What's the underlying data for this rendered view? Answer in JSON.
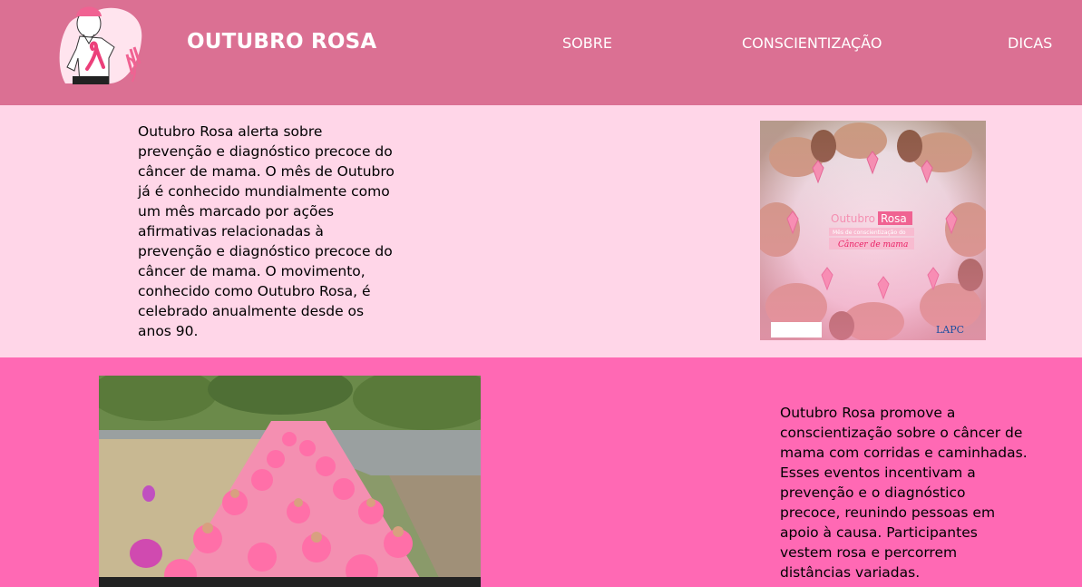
{
  "header": {
    "brand": "OUTUBRO ROSA",
    "nav": [
      {
        "label": "SOBRE"
      },
      {
        "label": "CONSCIENTIZAÇÃO"
      },
      {
        "label": "DICAS"
      }
    ]
  },
  "section1": {
    "text": "Outubro Rosa alerta sobre prevenção e diagnóstico precoce do câncer de mama. O mês de Outubro já é conhecido mundialmente como um mês marcado por ações afirmativas relacionadas à prevenção e diagnóstico precoce do câncer de mama. O movimento, conhecido como Outubro Rosa, é celebrado anualmente desde os anos 90.",
    "image": {
      "title_a": "Outubro",
      "title_b": "Rosa",
      "subtitle": "Mês de conscientização do",
      "script": "Câncer de mama",
      "logo": "LAPC"
    }
  },
  "section2": {
    "text": "Outubro Rosa promove a conscientização sobre o câncer de mama com corridas e caminhadas. Esses eventos incentivam a prevenção e o diagnóstico precoce, reunindo pessoas em apoio à causa. Participantes vestem rosa e percorrem distâncias variadas."
  },
  "colors": {
    "header": "#db7093",
    "section1": "#ffd6e8",
    "section2": "#ff69b4",
    "ribbon": "#f48fb1"
  }
}
